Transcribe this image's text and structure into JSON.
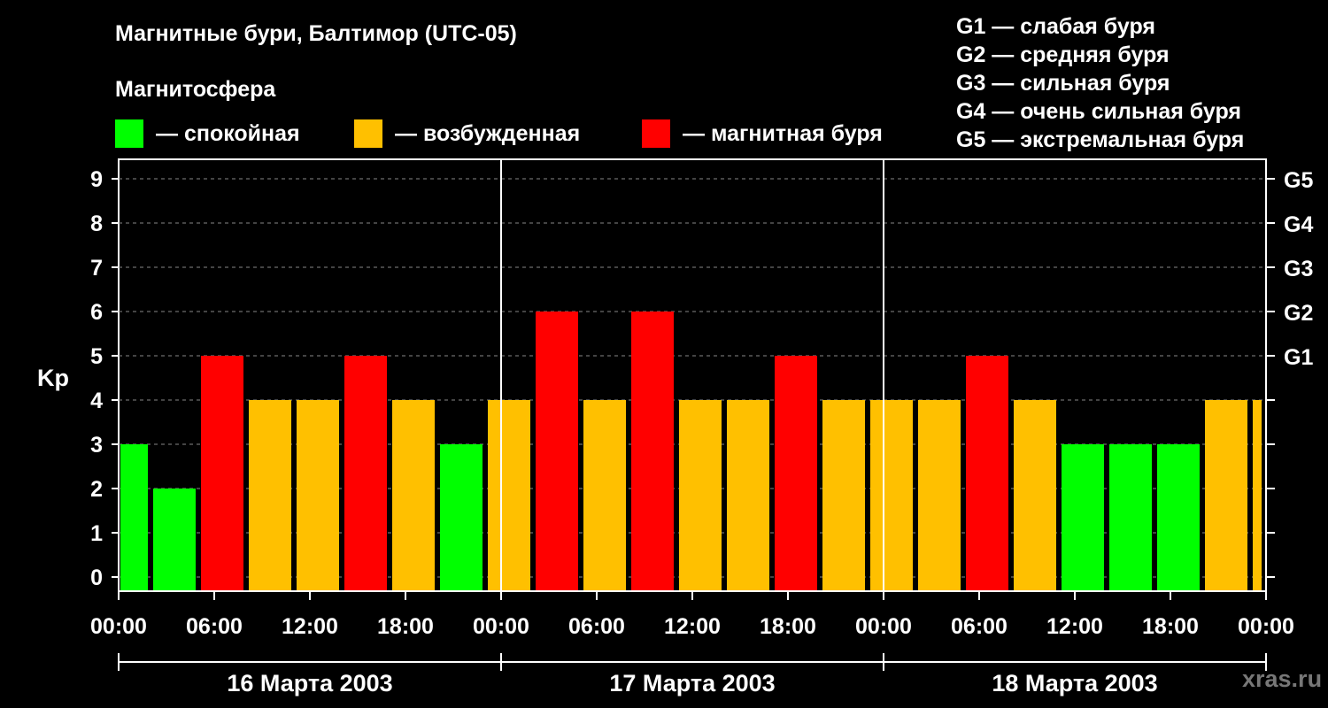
{
  "header": {
    "title": "Магнитные бури, Балтимор (UTC-05)",
    "magnetosphere_label": "Магнитосфера"
  },
  "legend": [
    {
      "label": "— спокойная",
      "color": "#00ff00"
    },
    {
      "label": "— возбужденная",
      "color": "#ffc000"
    },
    {
      "label": "— магнитная буря",
      "color": "#ff0000"
    }
  ],
  "g_scale": [
    {
      "label": "G1 — слабая буря"
    },
    {
      "label": "G2 — средняя буря"
    },
    {
      "label": "G3 — сильная буря"
    },
    {
      "label": "G4 — очень сильная буря"
    },
    {
      "label": "G5 — экстремальная буря"
    }
  ],
  "watermark": "xras.ru",
  "chart_data": {
    "type": "bar",
    "ylabel": "Kp",
    "ylim": [
      0,
      9
    ],
    "y_ticks": [
      "0",
      "1",
      "2",
      "3",
      "4",
      "5",
      "6",
      "7",
      "8",
      "9"
    ],
    "right_ticks": [
      {
        "value": 5,
        "label": "G1"
      },
      {
        "value": 6,
        "label": "G2"
      },
      {
        "value": 7,
        "label": "G3"
      },
      {
        "value": 8,
        "label": "G4"
      },
      {
        "value": 9,
        "label": "G5"
      }
    ],
    "x_tick_labels": [
      "00:00",
      "06:00",
      "12:00",
      "18:00",
      "00:00",
      "06:00",
      "12:00",
      "18:00",
      "00:00",
      "06:00",
      "12:00",
      "18:00",
      "00:00"
    ],
    "day_labels": [
      "16 Марта 2003",
      "17 Марта 2003",
      "18 Марта 2003"
    ],
    "hours_start": -1,
    "interval_hours": 3,
    "total_hours": 72,
    "values": [
      3,
      2,
      5,
      4,
      4,
      5,
      4,
      3,
      4,
      6,
      4,
      6,
      4,
      4,
      5,
      4,
      4,
      4,
      5,
      4,
      3,
      3,
      3,
      4,
      4
    ],
    "colors": {
      "quiet": "#00ff00",
      "active": "#ffc000",
      "storm": "#ff0000"
    },
    "grid": "dashed horizontal",
    "legend_position": "top"
  }
}
